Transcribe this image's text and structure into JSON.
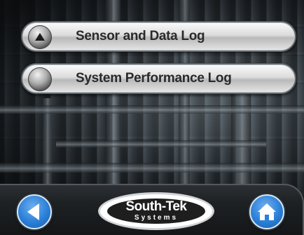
{
  "menu": {
    "items": [
      {
        "label": "Sensor and Data Log",
        "icon": "up-arrow-knob-icon"
      },
      {
        "label": "System Performance Log",
        "icon": "knob-icon"
      }
    ]
  },
  "footer": {
    "back_icon": "back-arrow-icon",
    "home_icon": "home-icon",
    "logo": {
      "main": "South-Tek",
      "sub": "Systems"
    }
  },
  "colors": {
    "button_blue": "#2a7fd8",
    "footer_bg": "#1e2124",
    "menu_button": "#dcdcdc"
  }
}
